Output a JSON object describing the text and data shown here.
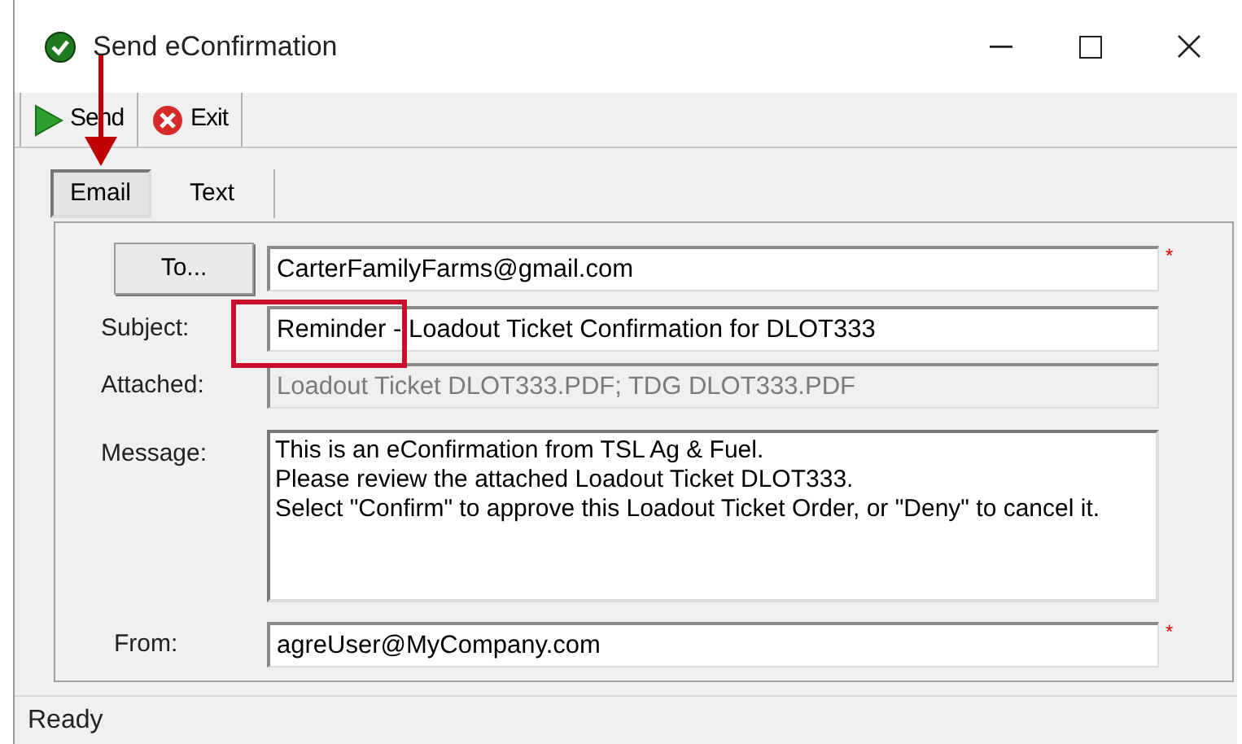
{
  "window": {
    "title": "Send eConfirmation"
  },
  "toolbar": [
    {
      "kind": "send",
      "label": "Send"
    },
    {
      "kind": "exit",
      "label": "Exit"
    }
  ],
  "tabs": [
    {
      "label": "Email",
      "selected": true
    },
    {
      "label": "Text",
      "selected": false
    }
  ],
  "form": {
    "to_button": "To...",
    "to": {
      "value": "CarterFamilyFarms@gmail.com",
      "required_mark": "*"
    },
    "subject": {
      "label": "Subject:",
      "value": "Reminder - Loadout Ticket Confirmation for DLOT333"
    },
    "attached": {
      "label": "Attached:",
      "value": "Loadout Ticket DLOT333.PDF; TDG DLOT333.PDF",
      "disabled": true
    },
    "message": {
      "label": "Message:",
      "lines": [
        "This is an eConfirmation from TSL Ag & Fuel.",
        "Please review the attached Loadout Ticket DLOT333.",
        "Select \"Confirm\" to approve this Loadout Ticket Order, or \"Deny\" to cancel it."
      ]
    },
    "from": {
      "label": "From:",
      "value": "agreUser@MyCompany.com",
      "required_mark": "*"
    }
  },
  "status_bar": "Ready"
}
